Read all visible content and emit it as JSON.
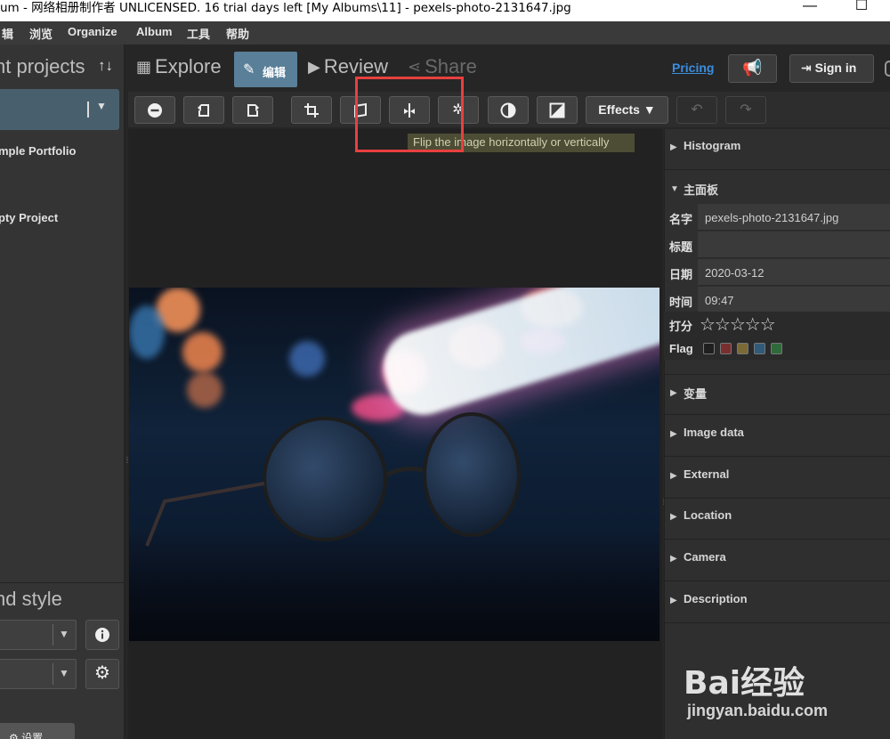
{
  "window": {
    "title": "um - 网络相册制作者 UNLICENSED. 16 trial days left [My Albums\\11] - pexels-photo-2131647.jpg",
    "minimize_icon": "minimize-icon",
    "maximize_icon": "maximize-icon"
  },
  "menu": {
    "items": [
      "辑",
      "浏览",
      "Organize",
      "Album",
      "工具",
      "帮助"
    ]
  },
  "left_panel": {
    "heading": "nt projects",
    "sort_icon": "↑↓",
    "projects": [
      "mple Portfolio",
      "pty Project"
    ],
    "style_heading": "nd style",
    "settings_label": "设置"
  },
  "nav": {
    "explore": "Explore",
    "edit": "编辑",
    "review": "Review",
    "share": "Share",
    "pricing": "Pricing",
    "sign_in": "Sign in"
  },
  "toolbar": {
    "effects_label": "Effects",
    "icons": [
      "minus-circle-icon",
      "rotate-left-icon",
      "rotate-right-icon",
      "crop-icon",
      "straighten-icon",
      "flip-icon",
      "gear-icon",
      "contrast-icon",
      "exposure-icon",
      "effects-dropdown",
      "undo-icon",
      "redo-icon"
    ]
  },
  "tooltip": "Flip the image horizontally or vertically",
  "right_panel": {
    "histogram": "Histogram",
    "main_panel": "主面板",
    "fields": [
      {
        "label": "名字",
        "value": "pexels-photo-2131647.jpg"
      },
      {
        "label": "标题",
        "value": ""
      },
      {
        "label": "日期",
        "value": "2020-03-12"
      },
      {
        "label": "时间",
        "value": "09:47"
      }
    ],
    "rating_label": "打分",
    "rating_stars": "☆☆☆☆☆",
    "rating_value": 0,
    "flag_label": "Flag",
    "flag_colors": [
      "#1f1f1f",
      "#7a2f2f",
      "#7b6a35",
      "#2f5a7a",
      "#2f6a3a"
    ],
    "sections": [
      "变量",
      "Image data",
      "External",
      "Location",
      "Camera",
      "Description"
    ]
  },
  "watermark": {
    "brand": "Bai经验",
    "url": "jingyan.baidu.com"
  },
  "colors": {
    "active_tab": "#5a7f98",
    "pricing_link": "#3b8ee0",
    "highlight_box": "#e8403f"
  }
}
